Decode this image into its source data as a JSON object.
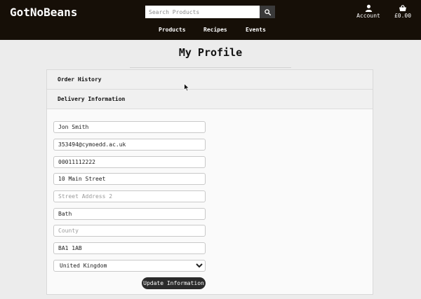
{
  "header": {
    "brand": "GotNoBeans",
    "search_placeholder": "Search Products",
    "account_label": "Account",
    "cart_total": "£0.00"
  },
  "nav": {
    "items": [
      "Products",
      "Recipes",
      "Events"
    ]
  },
  "page": {
    "title": "My Profile"
  },
  "accordion": {
    "order_history": "Order History",
    "delivery_information": "Delivery Information"
  },
  "form": {
    "name": "Jon Smith",
    "email": "353494@cymoedd.ac.uk",
    "phone": "00011112222",
    "address1": "10 Main Street",
    "address2_placeholder": "Street Address 2",
    "city": "Bath",
    "county_placeholder": "County",
    "postcode": "BA1 1AB",
    "country": "United Kingdom",
    "submit_label": "Update Information"
  },
  "colors": {
    "header_bg": "#160f07",
    "page_bg": "#ececec",
    "button_bg": "#2b2b2b"
  }
}
